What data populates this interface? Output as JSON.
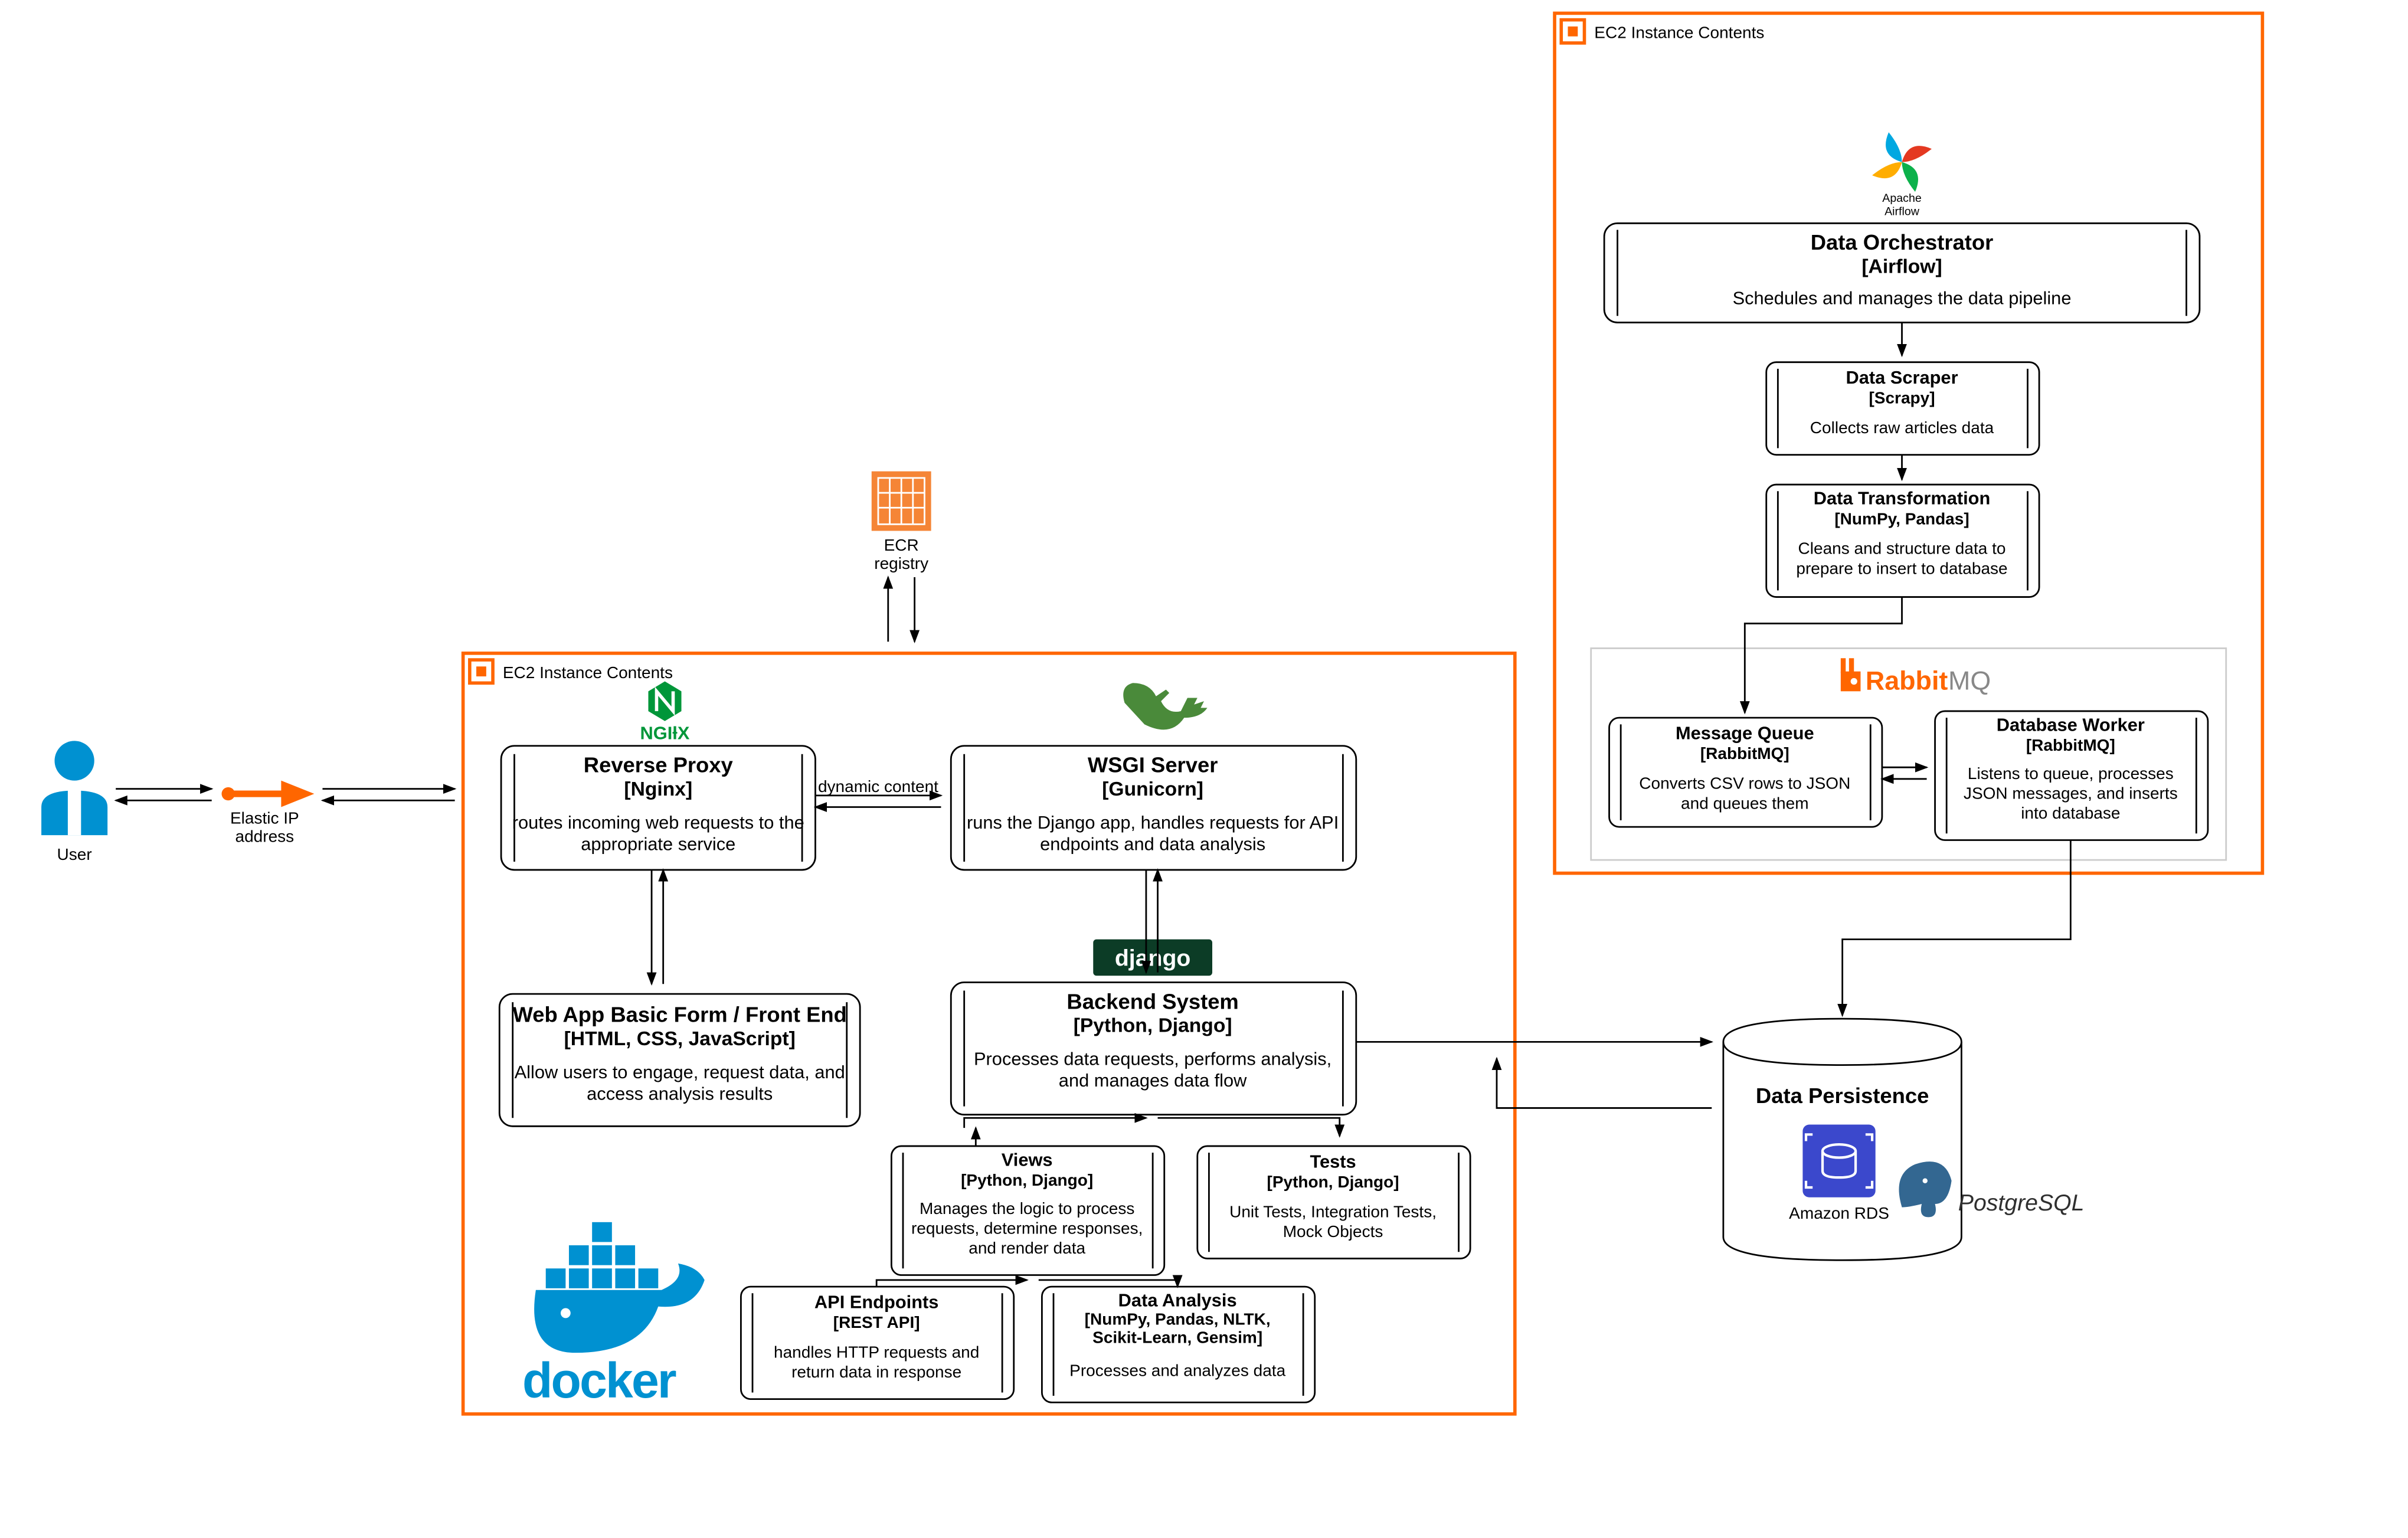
{
  "user": {
    "label": "User"
  },
  "eip": {
    "l1": "Elastic IP",
    "l2": "address"
  },
  "ecr": {
    "l1": "ECR",
    "l2": "registry"
  },
  "dynamic": "dynamic content",
  "left_container": "EC2 Instance Contents",
  "right_container": "EC2 Instance Contents",
  "reverse_proxy": {
    "title": "Reverse Proxy",
    "sub": "[Nginx]",
    "d1": "routes incoming web requests to the",
    "d2": "appropriate service"
  },
  "wsgi": {
    "title": "WSGI Server",
    "sub": "[Gunicorn]",
    "d1": "runs the Django app, handles requests for API",
    "d2": "endpoints and data analysis"
  },
  "frontend": {
    "title": "Web App Basic Form / Front End",
    "sub": "[HTML, CSS, JavaScript]",
    "d1": "Allow users to engage, request data, and",
    "d2": "access analysis results"
  },
  "backend": {
    "title": "Backend System",
    "sub": "[Python, Django]",
    "d1": "Processes data requests, performs analysis,",
    "d2": "and manages data flow"
  },
  "views": {
    "title": "Views",
    "sub": "[Python, Django]",
    "d1": "Manages the logic to process",
    "d2": "requests, determine responses,",
    "d3": "and render data"
  },
  "tests": {
    "title": "Tests",
    "sub": "[Python, Django]",
    "d1": "Unit Tests, Integration Tests,",
    "d2": "Mock Objects"
  },
  "api": {
    "title": "API Endpoints",
    "sub": "[REST API]",
    "d1": "handles HTTP requests and",
    "d2": "return data in response"
  },
  "analysis": {
    "title": "Data Analysis",
    "sub": "[NumPy, Pandas, NLTK,",
    "sub2": "Scikit-Learn, Gensim]",
    "d1": "Processes and analyzes data"
  },
  "orchestrator": {
    "title": "Data Orchestrator",
    "sub": "[Airflow]",
    "d1": "Schedules and manages the data pipeline"
  },
  "scraper": {
    "title": "Data Scraper",
    "sub": "[Scrapy]",
    "d1": "Collects raw articles data"
  },
  "transform": {
    "title": "Data Transformation",
    "sub": "[NumPy, Pandas]",
    "d1": "Cleans and structure data to",
    "d2": "prepare to insert to database"
  },
  "mq": {
    "title": "Message Queue",
    "sub": "[RabbitMQ]",
    "d1": "Converts CSV rows to JSON",
    "d2": "and queues them"
  },
  "dbworker": {
    "title": "Database Worker",
    "sub": "[RabbitMQ]",
    "d1": "Listens to queue, processes",
    "d2": "JSON messages, and inserts",
    "d3": "into database"
  },
  "persistence": {
    "title": "Data Persistence"
  },
  "rds_label": "Amazon RDS",
  "docker": "docker",
  "nginx": "NGIƚX",
  "django": "django",
  "postgres": "PostgreSQL",
  "rabbit1": "Rabbit",
  "rabbit2": "MQ",
  "airflow": {
    "l1": "Apache",
    "l2": "Airflow"
  }
}
